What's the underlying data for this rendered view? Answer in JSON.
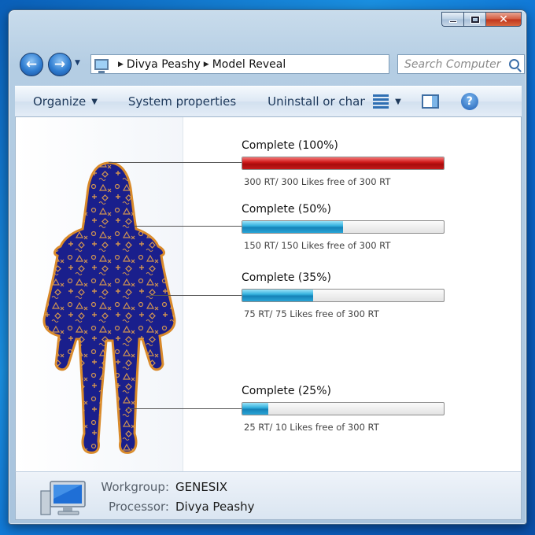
{
  "window": {
    "controls": {
      "minimize": "minimize",
      "maximize": "maximize",
      "close": "✕"
    }
  },
  "nav": {
    "back_icon": "arrow-left-icon",
    "forward_icon": "arrow-right-icon",
    "breadcrumb": [
      "Divya Peashy",
      "Model Reveal"
    ],
    "search_placeholder": "Search Computer"
  },
  "toolbar": {
    "organize": "Organize",
    "system_properties": "System properties",
    "uninstall": "Uninstall or change a program"
  },
  "progress_items": [
    {
      "title": "Complete (100%)",
      "percent": 100,
      "color": "red",
      "subtitle": "300 RT/ 300 Likes free of 300 RT"
    },
    {
      "title": "Complete (50%)",
      "percent": 50,
      "color": "blue",
      "subtitle": "150 RT/ 150 Likes free of 300 RT"
    },
    {
      "title": "Complete (35%)",
      "percent": 35,
      "color": "blue",
      "subtitle": "75 RT/ 75 Likes free of 300 RT"
    },
    {
      "title": "Complete (25%)",
      "percent": 13,
      "color": "blue",
      "subtitle": "25 RT/ 10 Likes free of 300 RT"
    }
  ],
  "details": {
    "workgroup_label": "Workgroup:",
    "workgroup_value": "GENESIX",
    "processor_label": "Processor:",
    "processor_value": "Divya Peashy"
  },
  "colors": {
    "silhouette_fill": "#1a1f8c",
    "silhouette_outline": "#d98a2a",
    "bar_red": "#c41a1a",
    "bar_blue": "#2aa4d6"
  }
}
